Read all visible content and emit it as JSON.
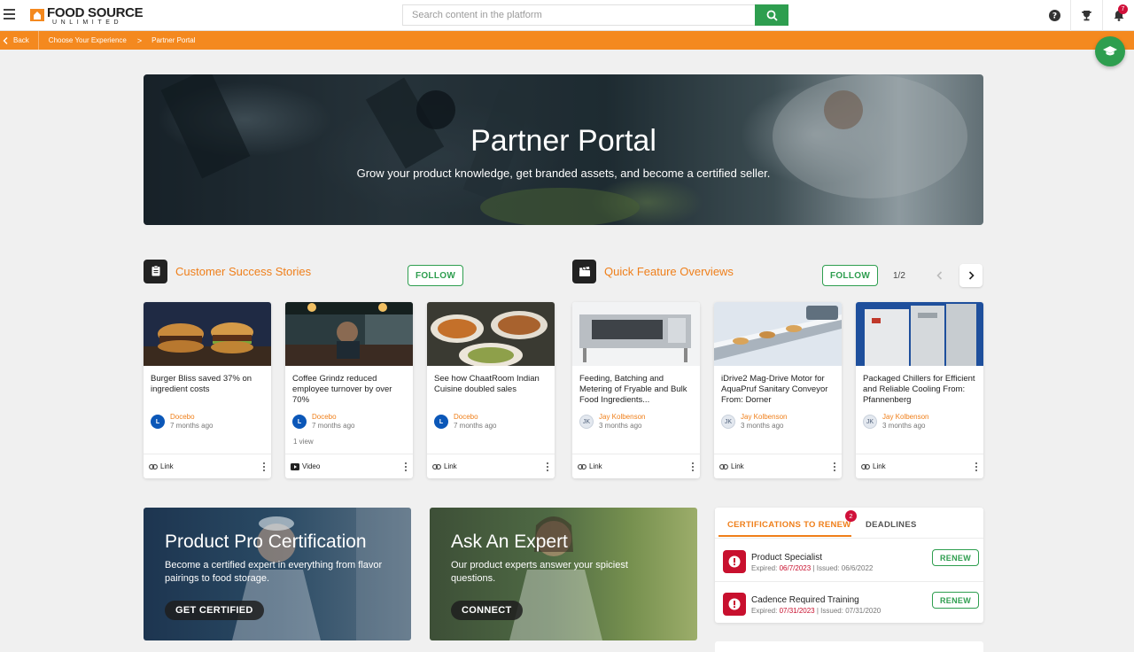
{
  "header": {
    "brand_line1": "FOOD SOURCE",
    "brand_line2": "UNLIMITED",
    "search_placeholder": "Search content in the platform",
    "notification_count": "7"
  },
  "breadcrumb": {
    "back": "Back",
    "items": [
      "Choose Your Experience",
      "Partner Portal"
    ],
    "separator": ">"
  },
  "hero": {
    "title": "Partner Portal",
    "subtitle": "Grow your product knowledge, get branded assets, and become a certified seller."
  },
  "sections": [
    {
      "title": "Customer Success Stories",
      "follow_label": "FOLLOW"
    },
    {
      "title": "Quick Feature Overviews",
      "follow_label": "FOLLOW",
      "pager": "1/2"
    }
  ],
  "cards": [
    {
      "title": "Burger Bliss saved 37% on ingredient costs",
      "author": "Docebo",
      "time": "7 months ago",
      "views": "",
      "type": "Link",
      "type_icon": "link-icon"
    },
    {
      "title": "Coffee Grindz reduced employee turnover by over 70%",
      "author": "Docebo",
      "time": "7 months ago",
      "views": "1 view",
      "type": "Video",
      "type_icon": "video-icon"
    },
    {
      "title": "See how ChaatRoom Indian Cuisine doubled sales",
      "author": "Docebo",
      "time": "7 months ago",
      "views": "",
      "type": "Link",
      "type_icon": "link-icon"
    },
    {
      "title": "Feeding, Batching and Metering of Fryable and Bulk Food Ingredients...",
      "author": "Jay Kolbenson",
      "initials": "JK",
      "time": "3 months ago",
      "views": "",
      "type": "Link",
      "type_icon": "link-icon"
    },
    {
      "title": "iDrive2 Mag-Drive Motor for AquaPruf Sanitary Conveyor From: Dorner",
      "author": "Jay Kolbenson",
      "initials": "JK",
      "time": "3 months ago",
      "views": "",
      "type": "Link",
      "type_icon": "link-icon"
    },
    {
      "title": "Packaged Chillers for Efficient and Reliable Cooling From: Pfannenberg",
      "author": "Jay Kolbenson",
      "initials": "JK",
      "time": "3 months ago",
      "views": "",
      "type": "Link",
      "type_icon": "link-icon"
    }
  ],
  "promos": [
    {
      "title": "Product Pro Certification",
      "text": "Become a certified expert in everything from flavor pairings to food storage.",
      "button": "GET CERTIFIED"
    },
    {
      "title": "Ask An Expert",
      "text": "Our product experts answer your spiciest questions.",
      "button": "CONNECT"
    }
  ],
  "certifications": {
    "tab_renew": "CERTIFICATIONS TO RENEW",
    "tab_renew_count": "2",
    "tab_deadlines": "DEADLINES",
    "expired_label": "Expired:",
    "issued_label": "Issued:",
    "renew_label": "RENEW",
    "items": [
      {
        "name": "Product Specialist",
        "expired": "06/7/2023",
        "issued": "06/6/2022"
      },
      {
        "name": "Cadence Required Training",
        "expired": "07/31/2023",
        "issued": "07/31/2020"
      }
    ]
  },
  "colors": {
    "accent_orange": "#f4891f",
    "accent_green": "#2e9e4f",
    "alert_red": "#c8102e"
  }
}
